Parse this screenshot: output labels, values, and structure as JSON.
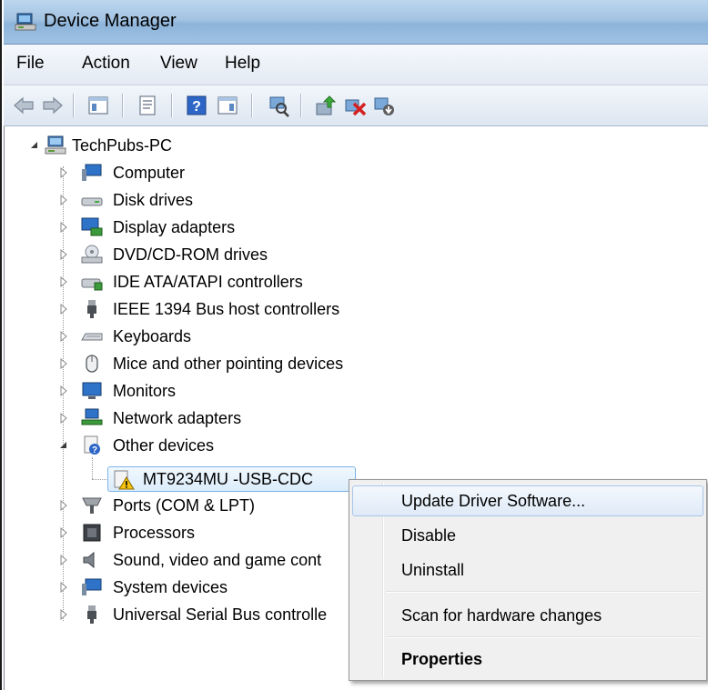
{
  "window": {
    "title": "Device Manager"
  },
  "menu": [
    "File",
    "Action",
    "View",
    "Help"
  ],
  "toolbar": {
    "buttons": [
      "back-icon",
      "forward-icon",
      "console-tree-icon",
      "properties-icon",
      "help-icon",
      "action-pane-icon",
      "scan-icon",
      "update-driver-icon",
      "disable-icon",
      "uninstall-icon"
    ]
  },
  "tree": {
    "root": "TechPubs-PC",
    "categories": [
      "Computer",
      "Disk drives",
      "Display adapters",
      "DVD/CD-ROM drives",
      "IDE ATA/ATAPI controllers",
      "IEEE 1394 Bus host controllers",
      "Keyboards",
      "Mice and other pointing devices",
      "Monitors",
      "Network adapters",
      "Other devices",
      "Ports (COM & LPT)",
      "Processors",
      "Sound, video and game cont",
      "System devices",
      "Universal Serial Bus controlle"
    ],
    "selected_device": "MT9234MU -USB-CDC"
  },
  "context_menu": {
    "update": "Update Driver Software...",
    "disable": "Disable",
    "uninstall": "Uninstall",
    "scan": "Scan for hardware changes",
    "properties": "Properties"
  },
  "colors": {
    "selection_border": "#7eb4ea",
    "warning": "#f5c211"
  }
}
